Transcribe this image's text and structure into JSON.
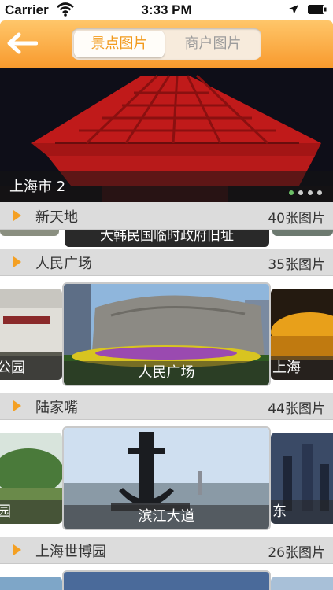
{
  "status_bar": {
    "carrier": "Carrier",
    "time": "3:33 PM"
  },
  "nav": {
    "segments": [
      {
        "label": "景点图片",
        "active": true
      },
      {
        "label": "商户图片",
        "active": false
      }
    ]
  },
  "banner": {
    "caption": "上海市 2",
    "page_index": 1,
    "page_count": 4
  },
  "sections": [
    {
      "name": "新天地",
      "count": "40张图片",
      "tiles": [
        {
          "label": "大韩民国临时政府旧址"
        }
      ]
    },
    {
      "name": "人民广场",
      "count": "35张图片",
      "tiles": [
        {
          "label": "公园"
        },
        {
          "label": "人民广场"
        },
        {
          "label": "上海"
        }
      ]
    },
    {
      "name": "陆家嘴",
      "count": "44张图片",
      "tiles": [
        {
          "label": "园"
        },
        {
          "label": "滨江大道"
        },
        {
          "label": "东"
        }
      ]
    },
    {
      "name": "上海世博园",
      "count": "26张图片"
    }
  ],
  "colors": {
    "accent": "#f4a023",
    "nav_top": "#ffc66a",
    "nav_bottom": "#f89a2e"
  }
}
